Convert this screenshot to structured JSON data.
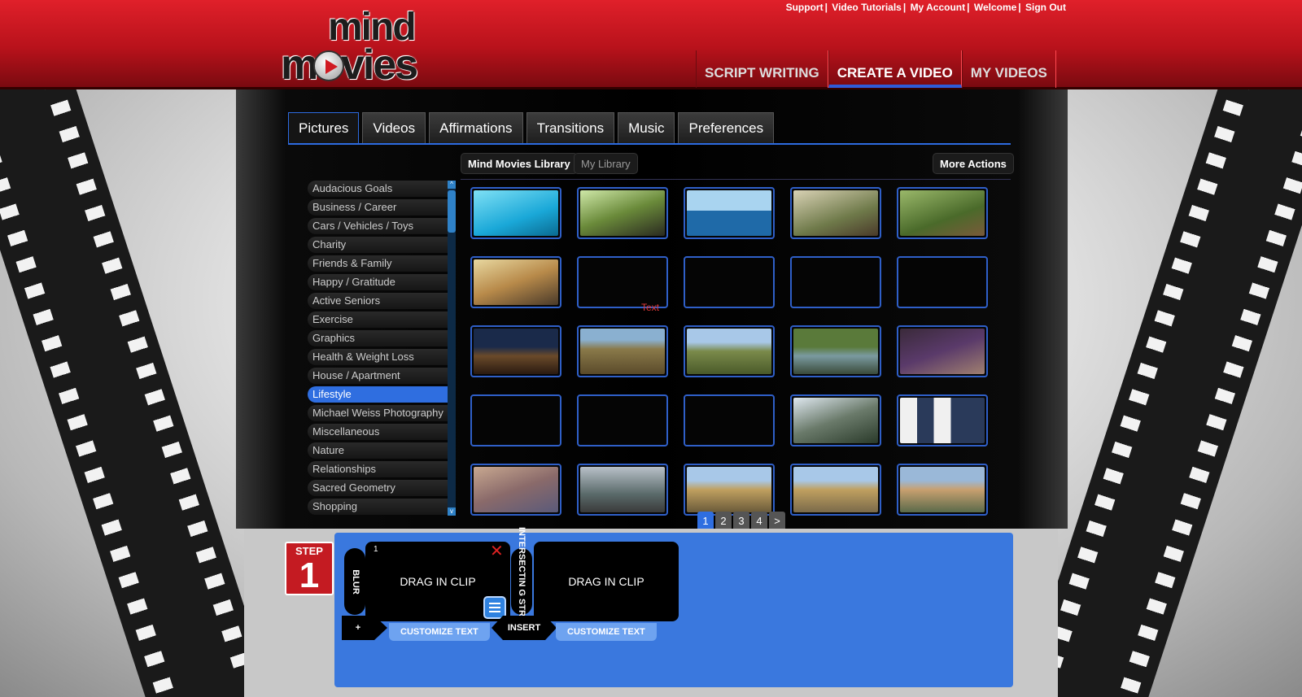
{
  "header": {
    "logo_line1": "mind",
    "logo_line2": "movies",
    "top_links": [
      "Support",
      "Video Tutorials",
      "My Account",
      "Welcome",
      "Sign Out"
    ],
    "nav": [
      "SCRIPT WRITING",
      "CREATE A VIDEO",
      "MY VIDEOS"
    ],
    "active_nav": "CREATE A VIDEO"
  },
  "tabs": [
    "Pictures",
    "Videos",
    "Affirmations",
    "Transitions",
    "Music",
    "Preferences"
  ],
  "library": {
    "mind_movies_library": "Mind Movies Library",
    "my_library": "My Library",
    "more_actions": "More Actions"
  },
  "categories": [
    "Audacious Goals",
    "Business / Career",
    "Cars / Vehicles / Toys",
    "Charity",
    "Friends & Family",
    "Happy / Gratitude",
    "Active Seniors",
    "Exercise",
    "Graphics",
    "Health & Weight Loss",
    "House / Apartment",
    "Lifestyle",
    "Michael Weiss Photography",
    "Miscellaneous",
    "Nature",
    "Relationships",
    "Sacred Geometry",
    "Shopping"
  ],
  "active_category": "Lifestyle",
  "grid_overlay_text": "Text",
  "pager": [
    "1",
    "2",
    "3",
    "4",
    ">"
  ],
  "timeline": {
    "step_label": "STEP",
    "step_number": "1",
    "clip_number": "1",
    "transition_1": "BLUR",
    "transition_2": "INTERSECTIN G STRIPES",
    "drag_clip": "DRAG IN CLIP",
    "customize_text": "CUSTOMIZE TEXT",
    "add_label": "+",
    "insert_label": "INSERT",
    "close_symbol": "✕"
  },
  "colors": {
    "header_red": "#c41b22",
    "accent_blue": "#2f6ee0",
    "timeline_blue": "#3a78de",
    "thumb_border": "#2f5fc8"
  }
}
